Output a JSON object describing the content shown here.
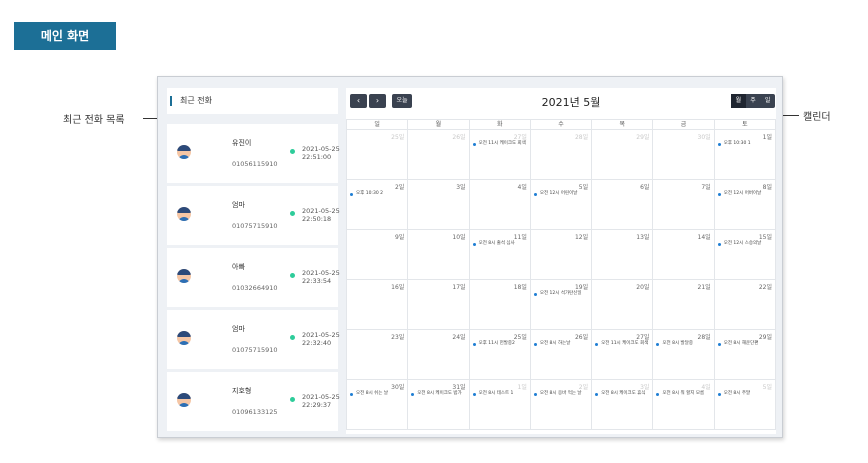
{
  "header": {
    "title": "메인 화면"
  },
  "annotations": {
    "recent_calls": "최근 전화 목록",
    "calendar": "캘린더"
  },
  "recent_calls": {
    "title": "최근 전화",
    "items": [
      {
        "name": "유진이",
        "number": "01056115910",
        "date": "2021-05-25",
        "time": "22:51:00"
      },
      {
        "name": "엄마",
        "number": "01075715910",
        "date": "2021-05-25",
        "time": "22:50:18"
      },
      {
        "name": "아빠",
        "number": "01032664910",
        "date": "2021-05-25",
        "time": "22:33:54"
      },
      {
        "name": "엄마",
        "number": "01075715910",
        "date": "2021-05-25",
        "time": "22:32:40"
      },
      {
        "name": "지호형",
        "number": "01096133125",
        "date": "2021-05-25",
        "time": "22:29:37"
      }
    ]
  },
  "calendar": {
    "title": "2021년 5월",
    "prev": "‹",
    "next": "›",
    "today": "오늘",
    "views": [
      "월",
      "주",
      "일"
    ],
    "active_view": "월",
    "weekdays": [
      "일",
      "월",
      "화",
      "수",
      "목",
      "금",
      "토"
    ],
    "event_color": "#1f7fd4",
    "weeks": [
      [
        {
          "day": "25일",
          "other": true
        },
        {
          "day": "26일",
          "other": true
        },
        {
          "day": "27일",
          "other": true,
          "event": "오전 11시 케이크도 회색"
        },
        {
          "day": "28일",
          "other": true
        },
        {
          "day": "29일",
          "other": true
        },
        {
          "day": "30일",
          "other": true
        },
        {
          "day": "1일",
          "event": "오후 10:30 1"
        }
      ],
      [
        {
          "day": "2일",
          "event": "오후 10:30 2"
        },
        {
          "day": "3일"
        },
        {
          "day": "4일"
        },
        {
          "day": "5일",
          "event": "오전 12시 어린이날"
        },
        {
          "day": "6일"
        },
        {
          "day": "7일"
        },
        {
          "day": "8일",
          "event": "오전 12시 어버이날"
        }
      ],
      [
        {
          "day": "9일"
        },
        {
          "day": "10일"
        },
        {
          "day": "11일",
          "event": "오전 8시 출석 심사"
        },
        {
          "day": "12일"
        },
        {
          "day": "13일"
        },
        {
          "day": "14일"
        },
        {
          "day": "15일",
          "event": "오전 12시 스승의날"
        }
      ],
      [
        {
          "day": "16일"
        },
        {
          "day": "17일"
        },
        {
          "day": "18일"
        },
        {
          "day": "19일",
          "event": "오전 12시 석가탄신일"
        },
        {
          "day": "20일"
        },
        {
          "day": "21일"
        },
        {
          "day": "22일"
        }
      ],
      [
        {
          "day": "23일"
        },
        {
          "day": "24일"
        },
        {
          "day": "25일",
          "event": "오후 11시 헌발중2"
        },
        {
          "day": "26일",
          "event": "오전 8시 하는날"
        },
        {
          "day": "27일",
          "event": "오전 11시 케이크도 회색"
        },
        {
          "day": "28일",
          "event": "오전 8시 발달중"
        },
        {
          "day": "29일",
          "event": "오전 8시 해운단편"
        }
      ],
      [
        {
          "day": "30일",
          "event": "오전 8시 쉬는 날"
        },
        {
          "day": "31일",
          "event": "오전 8시 케이크도 밤가"
        },
        {
          "day": "1일",
          "other": true,
          "event": "오전 8시 테스트 1"
        },
        {
          "day": "2일",
          "other": true,
          "event": "오전 8시 응바 먹는 날"
        },
        {
          "day": "3일",
          "other": true,
          "event": "오전 8시 케이크도 휴식"
        },
        {
          "day": "4일",
          "other": true,
          "event": "오전 8시 뭐 할지 모름"
        },
        {
          "day": "5일",
          "other": true,
          "event": "오전 8시 주말"
        }
      ]
    ]
  }
}
